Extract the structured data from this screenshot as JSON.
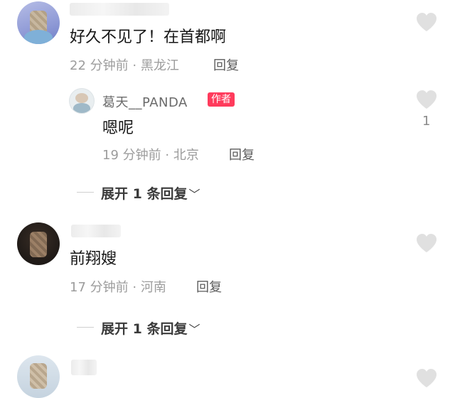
{
  "comments": [
    {
      "text": "好久不见了！在首都啊",
      "time": "22 分钟前",
      "sep": "·",
      "location": "黑龙江",
      "reply_label": "回复",
      "reply": {
        "username": "葛天__PANDA",
        "badge": "作者",
        "text": "嗯呢",
        "time": "19 分钟前",
        "sep": "·",
        "location": "北京",
        "reply_label": "回复",
        "like_count": "1"
      },
      "expand_label": "展开 1 条回复",
      "expand_icon": "chevron-down-icon"
    },
    {
      "text": "前翔嫂",
      "time": "17 分钟前",
      "sep": "·",
      "location": "河南",
      "reply_label": "回复",
      "expand_label": "展开 1 条回复",
      "expand_icon": "chevron-down-icon"
    }
  ],
  "icons": {
    "like": "heart-icon"
  },
  "colors": {
    "author_badge": "#ff3b5c",
    "heart": "#e0e0e0",
    "meta": "#9c9c9c"
  }
}
